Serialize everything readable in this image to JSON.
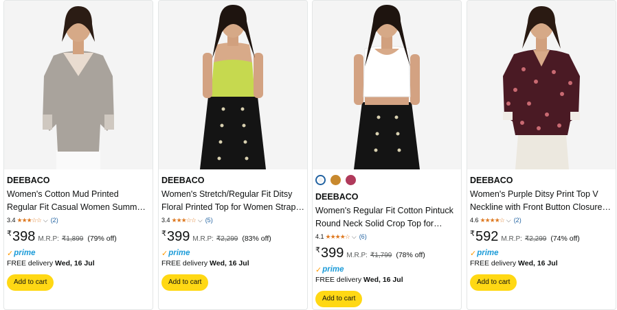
{
  "colors": {
    "accent_button": "#ffd814",
    "link": "#2162a1",
    "star": "#de7921",
    "prime_blue": "#1b9bd8",
    "prime_orange": "#ff9900"
  },
  "products": [
    {
      "image_icon": "model-mud-printed-top",
      "brand": "DEEBACO",
      "title": "Women's Cotton Mud Printed Regular Fit Casual Women Summer Top for…",
      "rating": "3.4",
      "rating_value": 3.4,
      "stars": "★★★☆☆",
      "review_count": "(2)",
      "currency": "₹",
      "price": "398",
      "mrp_label": "M.R.P:",
      "mrp": "₹1,899",
      "discount": "(79% off)",
      "prime": "prime",
      "delivery_prefix": "FREE delivery",
      "delivery_date": "Wed, 16 Jul",
      "cart_label": "Add to cart",
      "swatches": []
    },
    {
      "image_icon": "model-floral-strap-top",
      "brand": "DEEBACO",
      "title": "Women's Stretch/Regular Fit Ditsy Floral Printed Top for Women Strap…",
      "rating": "3.4",
      "rating_value": 3.4,
      "stars": "★★★☆☆",
      "review_count": "(5)",
      "currency": "₹",
      "price": "399",
      "mrp_label": "M.R.P:",
      "mrp": "₹2,299",
      "discount": "(83% off)",
      "prime": "prime",
      "delivery_prefix": "FREE delivery",
      "delivery_date": "Wed, 16 Jul",
      "cart_label": "Add to cart",
      "swatches": []
    },
    {
      "image_icon": "model-white-crop-top",
      "brand": "DEEBACO",
      "title": "Women's Regular Fit Cotton Pintuck Round Neck Solid Crop Top for…",
      "rating": "4.1",
      "rating_value": 4.1,
      "stars": "★★★★☆",
      "review_count": "(6)",
      "currency": "₹",
      "price": "399",
      "mrp_label": "M.R.P:",
      "mrp": "₹1,799",
      "discount": "(78% off)",
      "prime": "prime",
      "delivery_prefix": "FREE delivery",
      "delivery_date": "Wed, 16 Jul",
      "cart_label": "Add to cart",
      "swatches": [
        "#f2f2f2",
        "#c8892e",
        "#b03a5b"
      ]
    },
    {
      "image_icon": "model-purple-ditsy-top",
      "brand": "DEEBACO",
      "title": "Women's Purple Ditsy Print Top V Neckline with Front Button Closure…",
      "rating": "4.6",
      "rating_value": 4.6,
      "stars": "★★★★☆",
      "review_count": "(2)",
      "currency": "₹",
      "price": "592",
      "mrp_label": "M.R.P:",
      "mrp": "₹2,299",
      "discount": "(74% off)",
      "prime": "prime",
      "delivery_prefix": "FREE delivery",
      "delivery_date": "Wed, 16 Jul",
      "cart_label": "Add to cart",
      "swatches": []
    }
  ]
}
